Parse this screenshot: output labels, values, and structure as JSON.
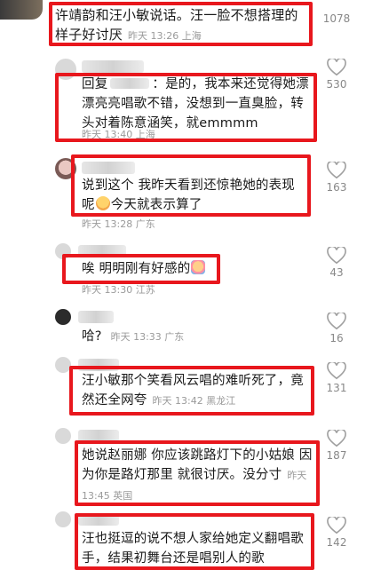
{
  "comments": [
    {
      "id": "c0",
      "avatar": "user-avatar",
      "text": "许靖韵和汪小敏说话。汪一脸不想搭理的样子好讨厌",
      "meta": "昨天 13:26 上海",
      "likes": "1078",
      "highlighted": true
    },
    {
      "id": "c1",
      "avatar": "user-avatar",
      "reply_prefix": "回复",
      "text": "：是的，我本来还觉得她漂漂亮亮唱歌不错，没想到一直臭脸，转头对着陈意涵笑，就emmmm",
      "meta": "昨天 13:40 上海",
      "likes": "530",
      "highlighted": true
    },
    {
      "id": "c2",
      "avatar": "user-avatar",
      "text_before_emoji": "说到这个 我昨天看到还惊艳她的表现呢",
      "emoji": "crying-face-emoji",
      "text_after_emoji": "今天就表示算了",
      "meta": "昨天 13:28 广东",
      "likes": "163",
      "highlighted": true
    },
    {
      "id": "c3",
      "avatar": "user-avatar",
      "text_before_emoji": "唉 明明刚有好感的",
      "emoji": "embarrassed-face-emoji",
      "meta": "昨天 13:30 江苏",
      "likes": "43",
      "highlighted": true
    },
    {
      "id": "c4",
      "avatar": "user-avatar",
      "text": "哈?",
      "meta": "昨天 13:33 广东",
      "likes": "16",
      "highlighted": false
    },
    {
      "id": "c5",
      "avatar": "user-avatar",
      "text": "汪小敏那个笑看风云唱的难听死了，竟然还全网夸",
      "meta": "昨天 13:42 黑龙江",
      "likes": "131",
      "highlighted": true
    },
    {
      "id": "c6",
      "avatar": "user-avatar",
      "text": "她说赵丽娜 你应该跳路灯下的小姑娘 因为你是路灯那里 就很讨厌。没分寸",
      "meta": "昨天 13:45 英国",
      "likes": "187",
      "highlighted": true
    },
    {
      "id": "c7",
      "avatar": "user-avatar",
      "text": "汪也挺逗的说不想人家给她定义翻唱歌手，结果初舞台还是唱别人的歌",
      "likes": "142",
      "highlighted": true
    }
  ],
  "colors": {
    "highlight_border": "#e8171d",
    "meta_text": "#9a9a9a",
    "like_count": "#888888"
  },
  "icons": {
    "like": "heart-outline-icon"
  }
}
